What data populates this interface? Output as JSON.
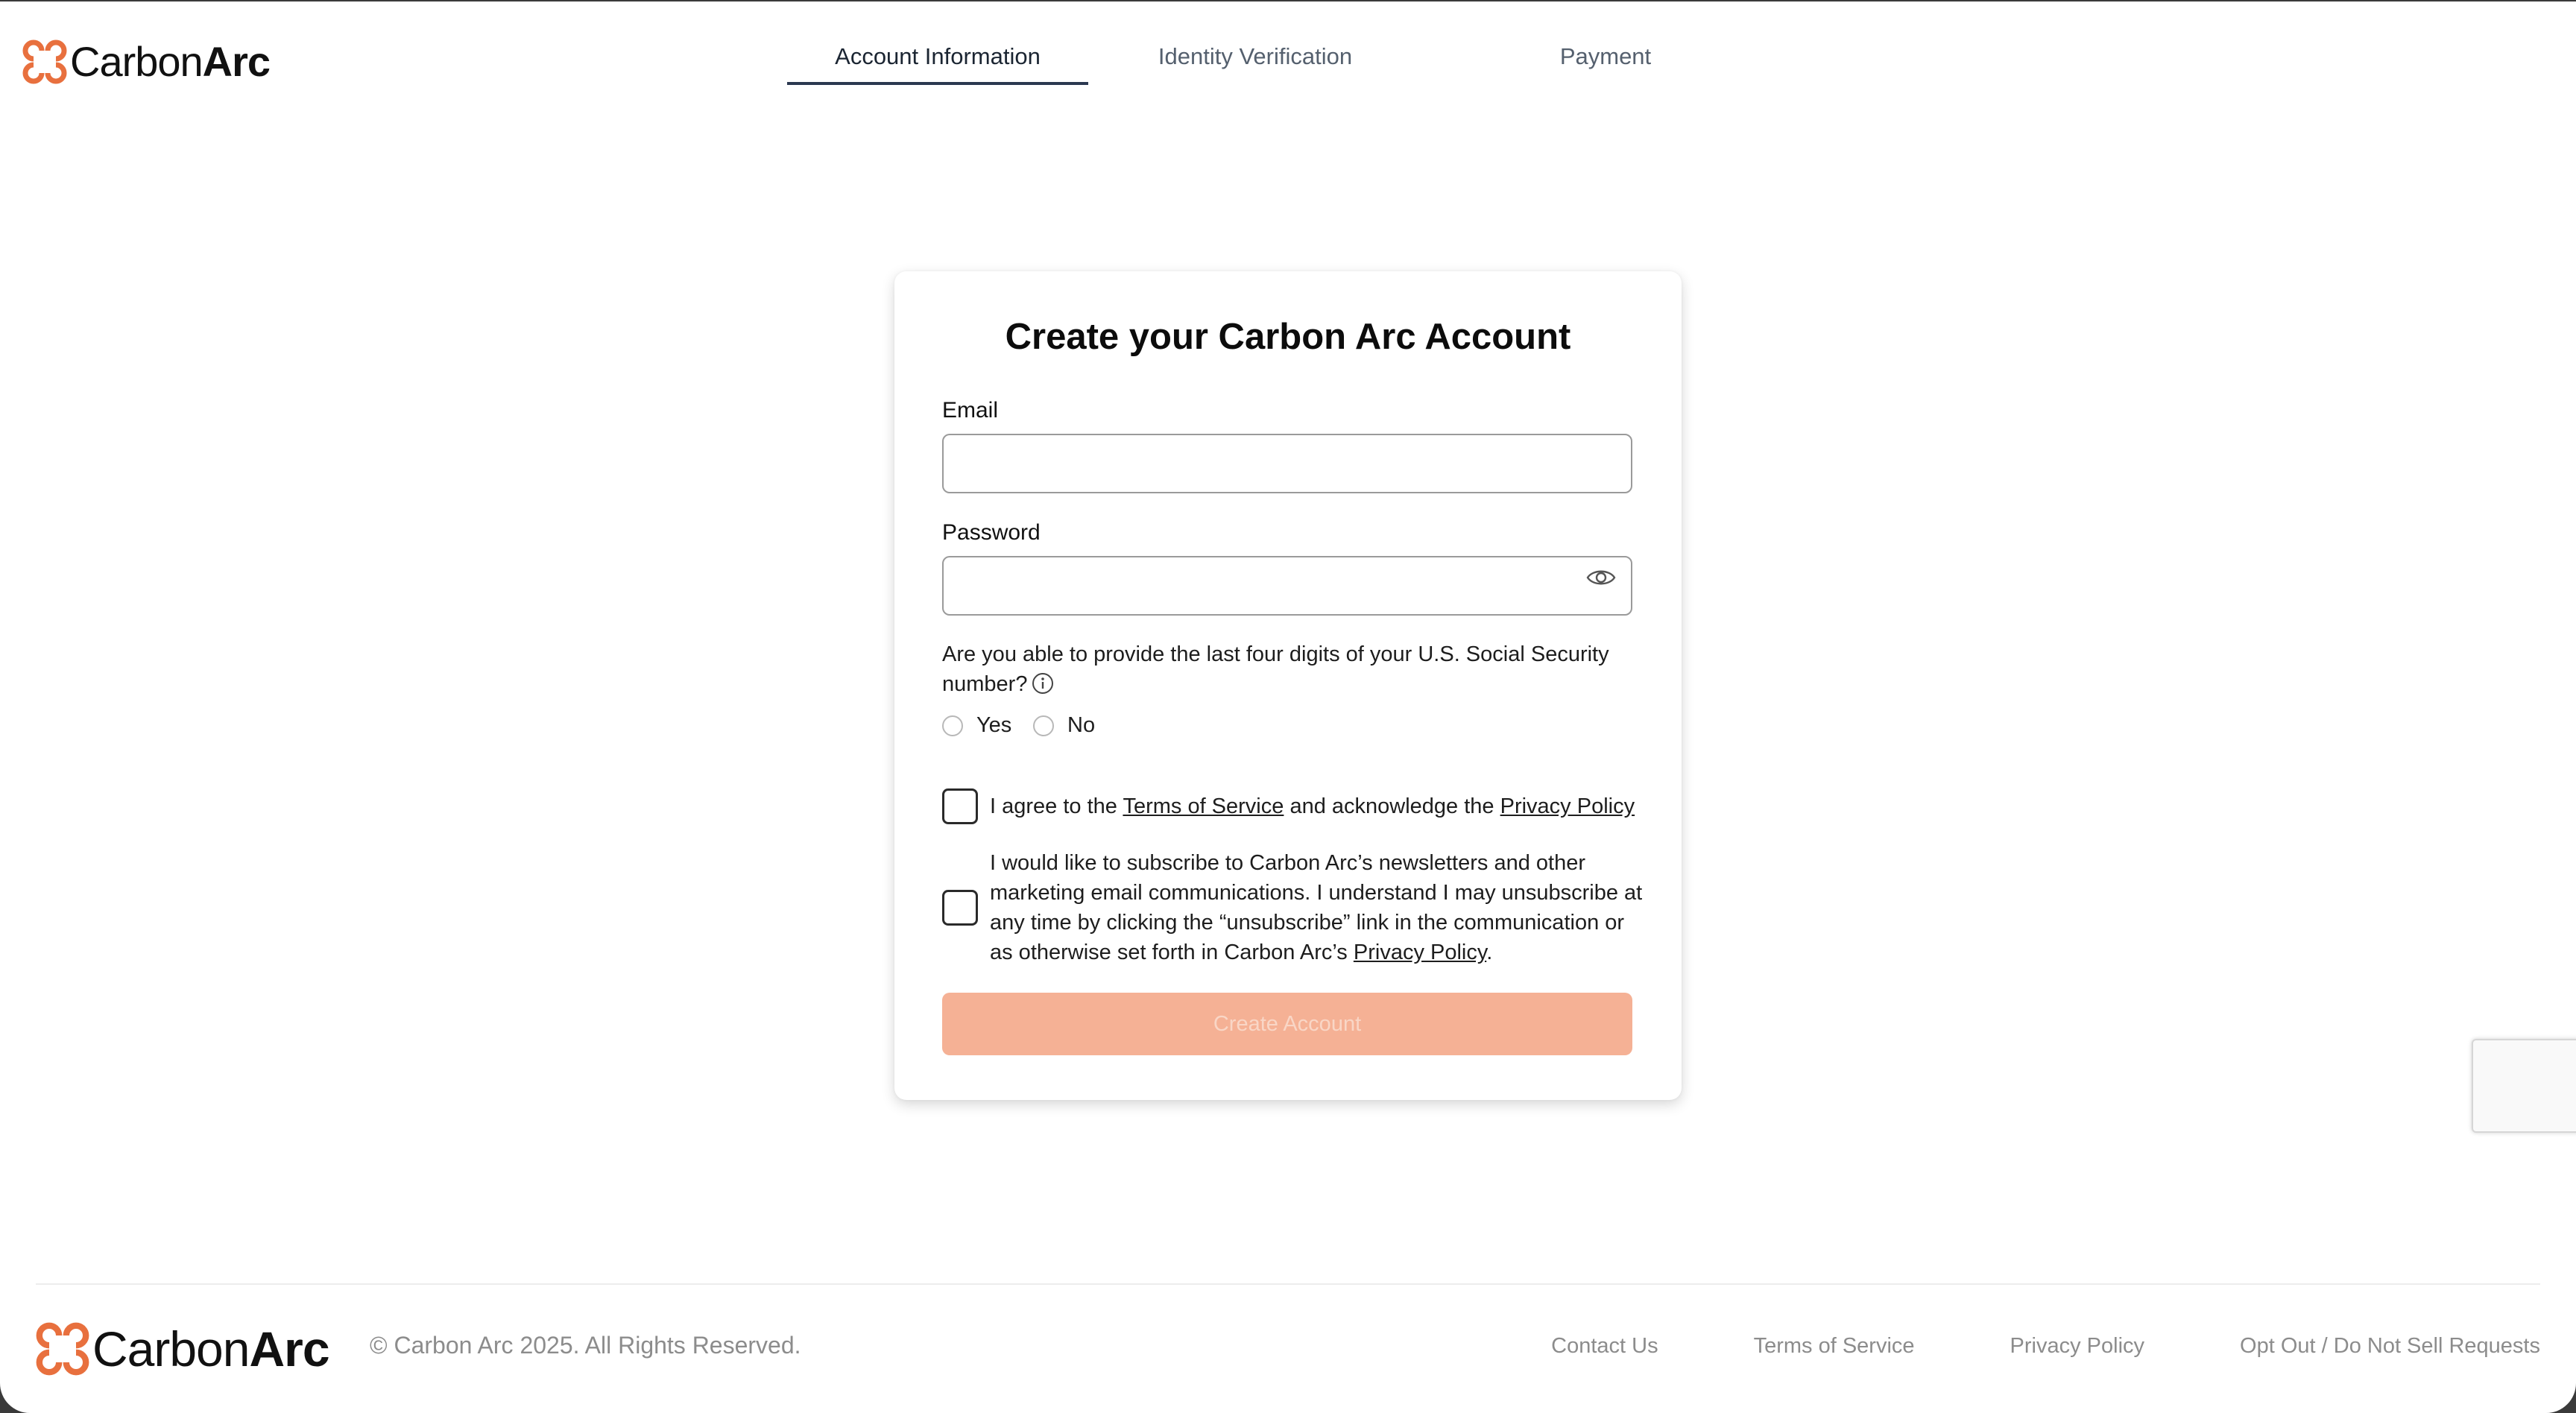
{
  "brand": {
    "name_regular": "Carbon",
    "name_bold": "Arc",
    "accent_color": "#e8703e",
    "logo_icon": "carbon-arc-logo-icon"
  },
  "tabs": [
    {
      "label": "Account Information",
      "active": true
    },
    {
      "label": "Identity Verification",
      "active": false
    },
    {
      "label": "Payment",
      "active": false
    }
  ],
  "form": {
    "title": "Create your Carbon Arc Account",
    "email": {
      "label": "Email",
      "value": "",
      "placeholder": ""
    },
    "password": {
      "label": "Password",
      "value": "",
      "placeholder": "",
      "icon": "eye-icon"
    },
    "ssn_question": "Are you able to provide the last four digits of your U.S. Social Security number?",
    "ssn_info_icon": "info-icon",
    "ssn_options": [
      "Yes",
      "No"
    ],
    "terms": {
      "prefix": "I agree to the ",
      "terms_link": "Terms of Service",
      "middle": " and acknowledge the ",
      "privacy_link": "Privacy Policy",
      "checked": false
    },
    "newsletter": {
      "text": "I would like to subscribe to Carbon Arc’s newsletters and other marketing email communications. I understand I may unsubscribe at any time by clicking the “unsubscribe” link in the communication or as otherwise set forth in Carbon Arc’s ",
      "privacy_link": "Privacy Policy",
      "suffix": ".",
      "checked": false
    },
    "submit_label": "Create Account",
    "submit_color": "#f5b195"
  },
  "footer": {
    "copyright": "© Carbon Arc 2025. All Rights Reserved.",
    "links": [
      "Contact Us",
      "Terms of Service",
      "Privacy Policy",
      "Opt Out / Do Not Sell Requests"
    ]
  }
}
